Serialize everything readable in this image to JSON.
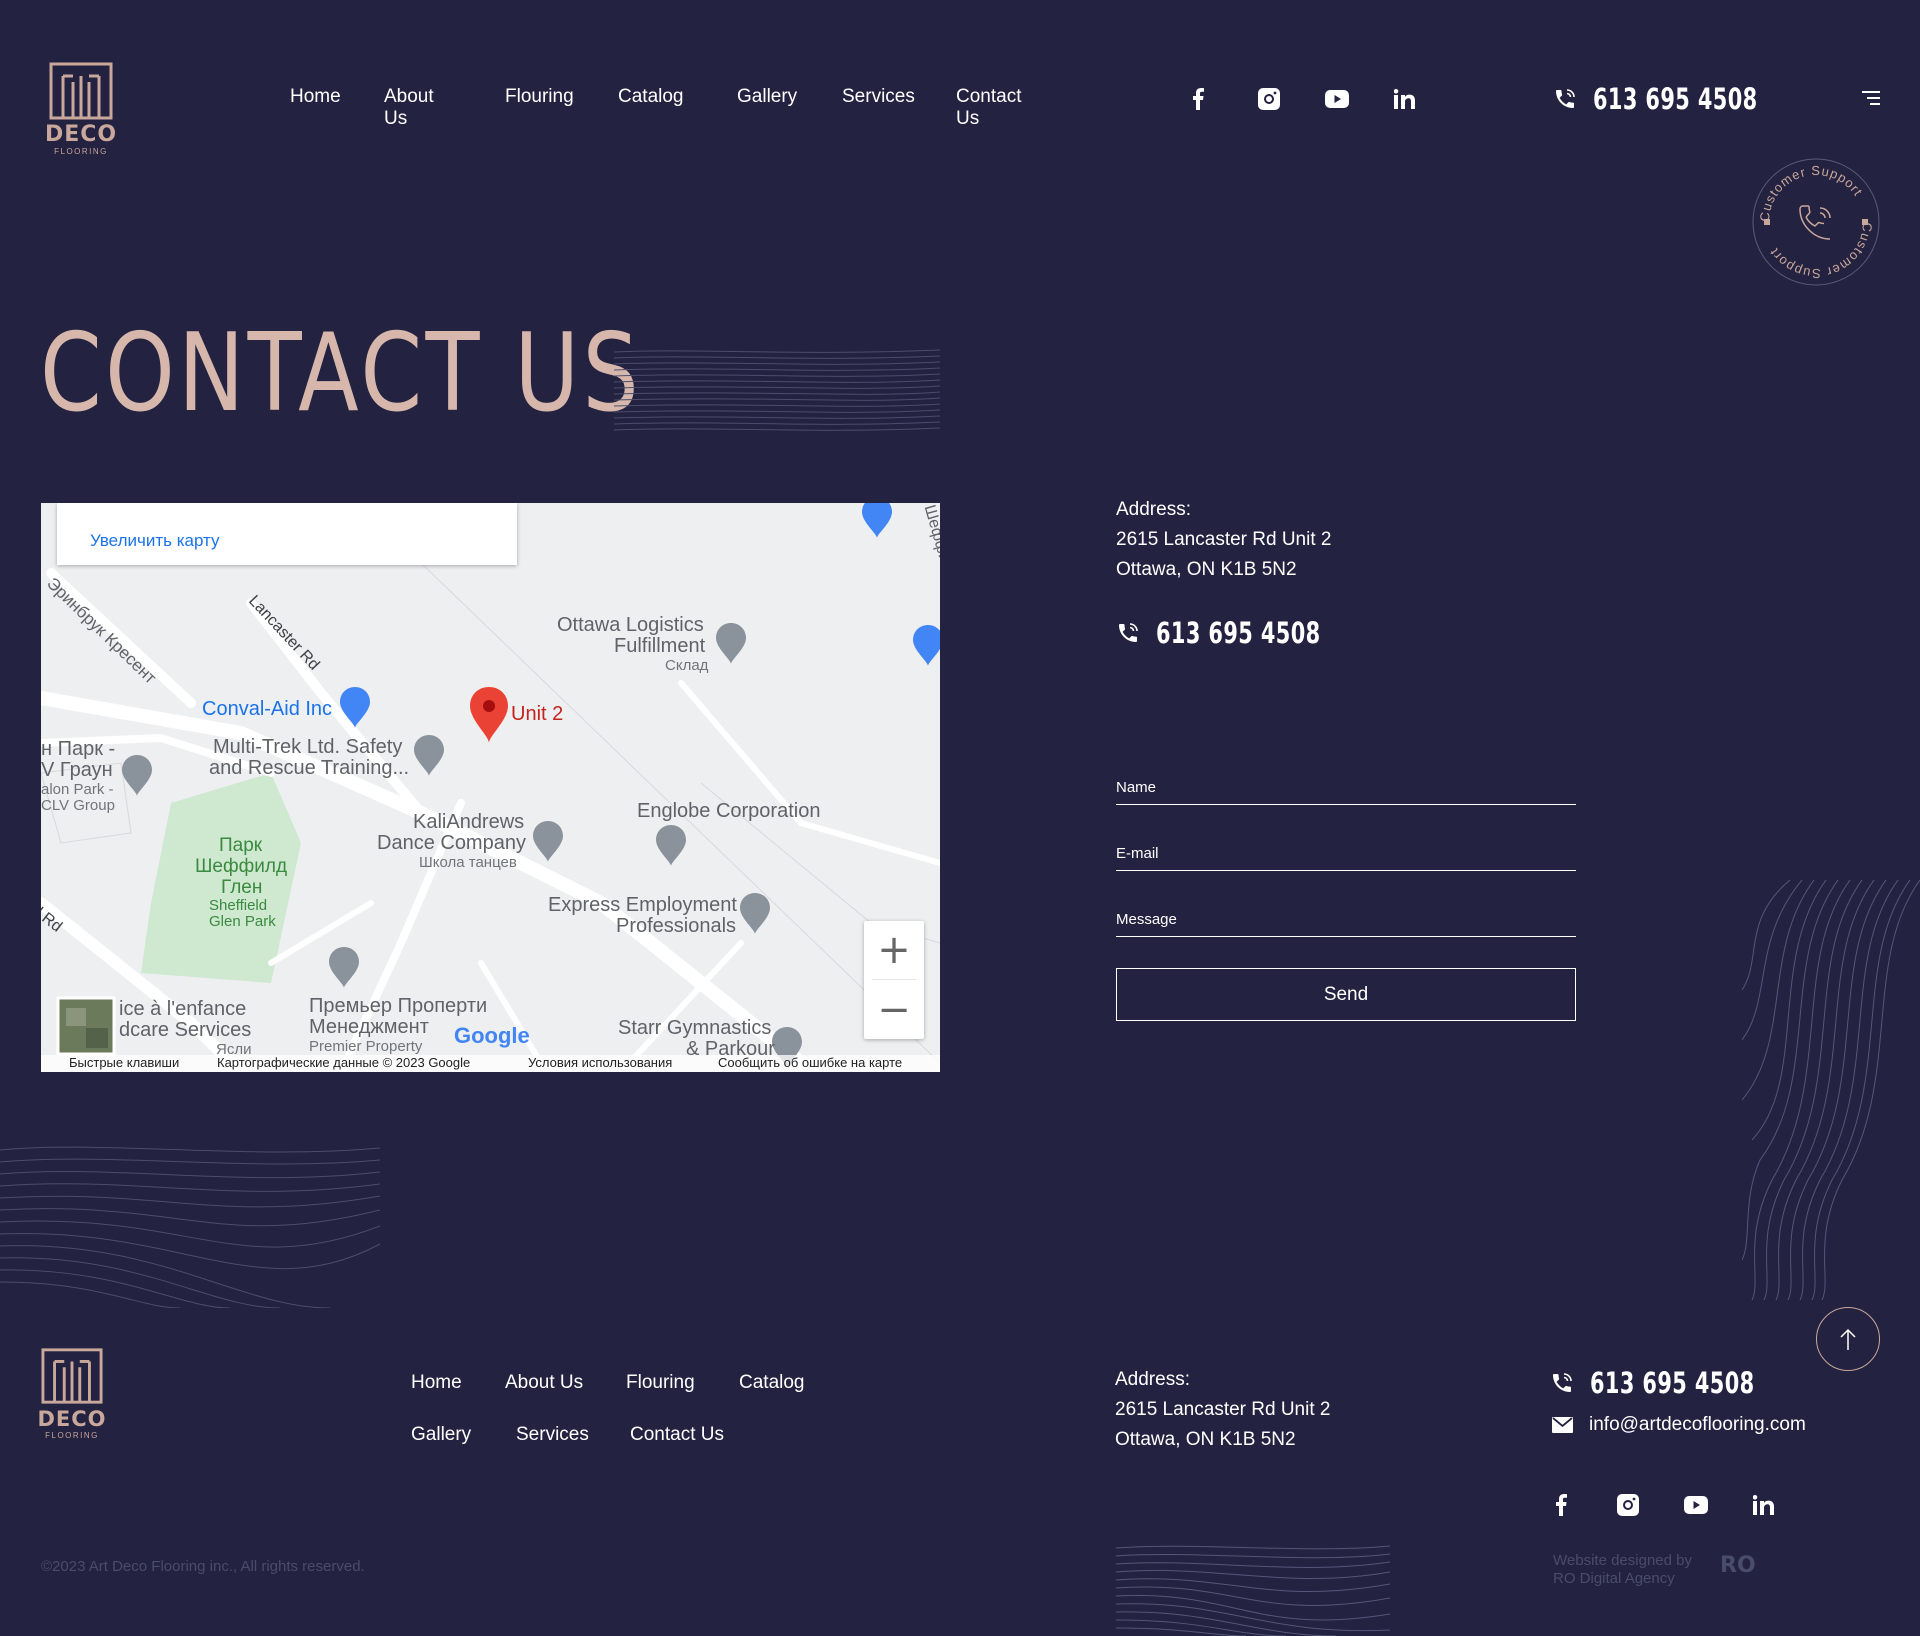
{
  "colors": {
    "background": "#232240",
    "accent": "#d7b7ac",
    "logo": "#c9a79b",
    "muted": "#4a4c6b",
    "map_pin": "#ea4335"
  },
  "header": {
    "logo": {
      "word": "DECO",
      "sub": "FLOORING"
    },
    "nav": [
      "Home",
      "About Us",
      "Flouring",
      "Catalog",
      "Gallery",
      "Services",
      "Contact Us"
    ],
    "social_icons": [
      "facebook-icon",
      "instagram-icon",
      "youtube-icon",
      "linkedin-icon"
    ],
    "phone": "613 695 4508",
    "menu_icon": "menu-icon"
  },
  "support_badge": {
    "text": "Customer Support",
    "icon": "phone-icon"
  },
  "page_title": "CONTACT US",
  "map": {
    "enlarge": "Увеличить карту",
    "pin_label": "Unit 2",
    "labels": {
      "street1": "Эринбрук Кресент",
      "street2": "Lancaster Rd",
      "ottawa_logistics": "Ottawa Logistics",
      "fulfillment": "Fulfillment",
      "sklad": "Склад",
      "conval": "Conval-Aid Inc",
      "multitrek1": "Multi-Trek Ltd. Safety",
      "multitrek2": "and Rescue Training...",
      "park_left1": "н Парк -",
      "park_left2": "V Граун",
      "park_left3": "alon Park -",
      "park_left4": "CLV Group",
      "kali1": "KaliAndrews",
      "kali2": "Dance Company",
      "kali3": "Школа танцев",
      "englobe": "Englobe Corporation",
      "park1": "Парк",
      "park2": "Шеффилд",
      "park3": "Глен",
      "park4": "Sheffield",
      "park5": "Glen Park",
      "express1": "Express Employment",
      "express2": "Professionals",
      "street3": "ll Rd",
      "enfance1": "ice à l'enfance",
      "enfance2": "dcare Services",
      "enfance3": "Ясли",
      "premier1": "Премьер Проперти",
      "premier2": "Менеджмент",
      "premier3": "Premier Property",
      "starr1": "Starr Gymnastics",
      "starr2": "& Parkour",
      "google": "Google",
      "right_street": "Шеффилд"
    },
    "attribution": [
      "Быстрые клавиши",
      "Картографические данные © 2023 Google",
      "Условия использования",
      "Сообщить об ошибке на карте"
    ]
  },
  "contact": {
    "address_label": "Address:",
    "address_line1": "2615 Lancaster Rd Unit 2",
    "address_line2": "Ottawa, ON K1B 5N2",
    "phone": "613 695 4508"
  },
  "form": {
    "name_label": "Name",
    "email_label": "E-mail",
    "message_label": "Message",
    "send_label": "Send"
  },
  "footer": {
    "logo": {
      "word": "DECO",
      "sub": "FLOORING"
    },
    "nav_row1": [
      "Home",
      "About Us",
      "Flouring",
      "Catalog"
    ],
    "nav_row2": [
      "Gallery",
      "Services",
      "Contact Us"
    ],
    "address_label": "Address:",
    "address_line1": "2615 Lancaster Rd Unit 2",
    "address_line2": "Ottawa, ON K1B 5N2",
    "phone": "613 695 4508",
    "email": "info@artdecoflooring.com",
    "copyright": "©2023 Art Deco Flooring inc., All rights reserved.",
    "credit_line1": "Website designed by",
    "credit_line2": "RO Digital Agency",
    "credit_logo": "RO"
  }
}
